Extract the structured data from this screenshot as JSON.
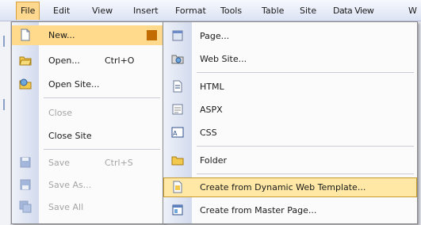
{
  "menubar": {
    "items": [
      "File",
      "Edit",
      "View",
      "Insert",
      "Format",
      "Tools",
      "Table",
      "Site",
      "Data View",
      "W"
    ]
  },
  "file_menu": {
    "items": [
      {
        "label": "New...",
        "icon": "new-page-icon",
        "state": "open",
        "submenu": true
      },
      {
        "label": "Open...",
        "shortcut": "Ctrl+O",
        "icon": "open-folder-icon"
      },
      {
        "label": "Open Site...",
        "icon": "open-site-icon"
      },
      {
        "label": "Close",
        "disabled": true
      },
      {
        "label": "Close Site"
      },
      {
        "label": "Save",
        "shortcut": "Ctrl+S",
        "icon": "save-icon",
        "disabled": true
      },
      {
        "label": "Save As...",
        "icon": "save-as-icon",
        "disabled": true
      },
      {
        "label": "Save All",
        "icon": "save-all-icon",
        "disabled": true
      }
    ]
  },
  "new_submenu": {
    "items": [
      {
        "label": "Page...",
        "icon": "page-icon"
      },
      {
        "label": "Web Site...",
        "icon": "web-site-icon"
      },
      {
        "label": "HTML",
        "icon": "html-icon"
      },
      {
        "label": "ASPX",
        "icon": "aspx-icon"
      },
      {
        "label": "CSS",
        "icon": "css-icon"
      },
      {
        "label": "Folder",
        "icon": "folder-icon"
      },
      {
        "label": "Create from Dynamic Web Template...",
        "icon": "dwt-icon",
        "state": "hover"
      },
      {
        "label": "Create from Master Page...",
        "icon": "master-page-icon"
      }
    ]
  },
  "colors": {
    "highlight": "#ffe8a6",
    "highlight_border": "#c89a2e",
    "disabled_text": "#a4a4a4"
  }
}
